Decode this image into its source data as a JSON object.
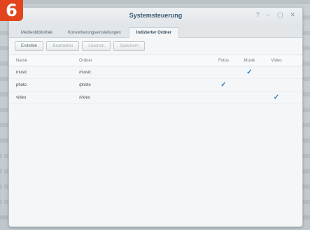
{
  "step_badge": "6",
  "window": {
    "title": "Systemsteuerung",
    "controls": [
      "?",
      "–",
      "▢",
      "✕"
    ]
  },
  "tabs": [
    {
      "label": "Medienbibliothek",
      "active": false
    },
    {
      "label": "Konvertierungseinstellungen",
      "active": false
    },
    {
      "label": "Indizierter Ordner",
      "active": true
    }
  ],
  "toolbar": {
    "create": "Erstellen",
    "edit": "Bearbeiten",
    "delete": "Löschen",
    "save": "Speichern"
  },
  "table": {
    "headers": {
      "name": "Name",
      "folder": "Ordner",
      "fotos": "Fotos",
      "musik": "Musik",
      "video": "Video"
    },
    "rows": [
      {
        "name": "music",
        "folder": "/music",
        "fotos": false,
        "musik": true,
        "video": false
      },
      {
        "name": "photo",
        "folder": "/photo",
        "fotos": true,
        "musik": false,
        "video": false
      },
      {
        "name": "video",
        "folder": "/video",
        "fotos": false,
        "musik": false,
        "video": true
      }
    ]
  },
  "icons": {
    "check": "checkmark-icon"
  },
  "colors": {
    "badge": "#e2451d",
    "check": "#2d7fd0",
    "title": "#3c5a73"
  }
}
